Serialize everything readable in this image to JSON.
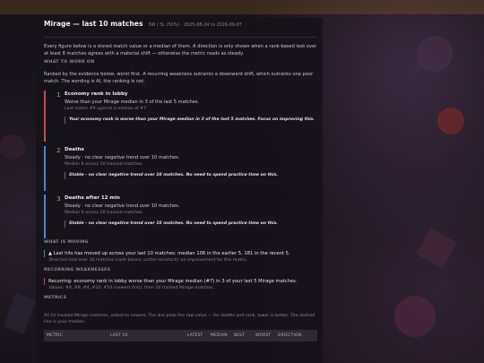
{
  "header": {
    "title": "Mirage — last 10 matches",
    "meta": "5W / 5L (50%) · 2025-08-24 to 2026-09-07"
  },
  "intro": "Every figure below is a stored match value or a median of them. A direction is only shown when a rank-based test over at least 8 matches agrees with a material shift — otherwise the metric reads as steady.",
  "what_to_work_on": {
    "heading": "WHAT TO WORK ON",
    "description": "Ranked by the evidence below, worst first. A recurring weakness outranks a downward drift, which outranks one poor match. The wording is AI, the ranking is not.",
    "items": [
      {
        "number": "1",
        "title": "Economy rank in lobby",
        "line": "Worse than your Mirage median in 3 of the last 5 matches.",
        "sub": "Last match #9 against a median of #7",
        "quote": "Your economy rank is worse than your Mirage median in 3 of the last 5 matches. Focus on improving this.",
        "color": "#c9484c"
      },
      {
        "number": "2",
        "title": "Deaths",
        "line": "Steady · no clear negative trend over 10 matches.",
        "sub": "Median 6 across 10 tracked matches.",
        "quote": "Stable - no clear negative trend over 10 matches. No need to spend practice time on this.",
        "color": "#4a86c8"
      },
      {
        "number": "3",
        "title": "Deaths after 12 min",
        "line": "Steady · no clear negative trend over 10 matches.",
        "sub": "Median 4 across 10 tracked matches.",
        "quote": "Stable - no clear negative trend over 10 matches. No need to spend practice time on this.",
        "color": "#4a86c8"
      }
    ]
  },
  "what_is_moving": {
    "heading": "WHAT IS MOVING",
    "line": "▲ Last hits has moved up across your last 10 matches: median 106 in the earlier 5, 181 in the recent 5.",
    "sub": "Direction test over 10 matches (rank-based, outlier-resistant); an improvement for this metric."
  },
  "recurring": {
    "heading": "RECURRING WEAKNESSES",
    "line": "Recurring: economy rank in lobby worse than your Mirage median (#7) in 3 of your last 5 Mirage matches.",
    "sub": "Values: #9, #8, #4, #10, #10 (newest first), from 10 tracked Mirage matches."
  },
  "metrics": {
    "heading": "METRICS",
    "caption": "All 10 tracked Mirage matches, oldest to newest. The line plots the raw value — for deaths and rank, lower is better. The dashed line is your median.",
    "columns": [
      "METRIC",
      "LAST 10",
      "LATEST",
      "MEDIAN",
      "BEST",
      "WORST",
      "DIRECTION"
    ]
  }
}
